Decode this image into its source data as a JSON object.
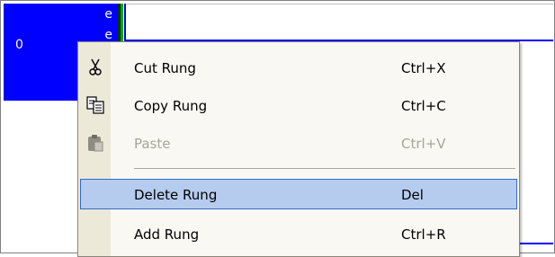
{
  "rung": {
    "number": "0",
    "marker_top": "e",
    "marker_bottom": "e"
  },
  "colors": {
    "rung_bg": "#0000ff",
    "menu_bg": "#f9f8f3",
    "highlight": "#b6ccee",
    "highlight_border": "#316ac5"
  },
  "menu": {
    "cut": {
      "label": "Cut Rung",
      "shortcut": "Ctrl+X",
      "icon": "scissors-icon"
    },
    "copy": {
      "label": "Copy Rung",
      "shortcut": "Ctrl+C",
      "icon": "copy-icon"
    },
    "paste": {
      "label": "Paste",
      "shortcut": "Ctrl+V",
      "icon": "paste-icon",
      "disabled": true
    },
    "delete": {
      "label": "Delete Rung",
      "shortcut": "Del",
      "highlighted": true
    },
    "add": {
      "label": "Add Rung",
      "shortcut": "Ctrl+R"
    }
  }
}
